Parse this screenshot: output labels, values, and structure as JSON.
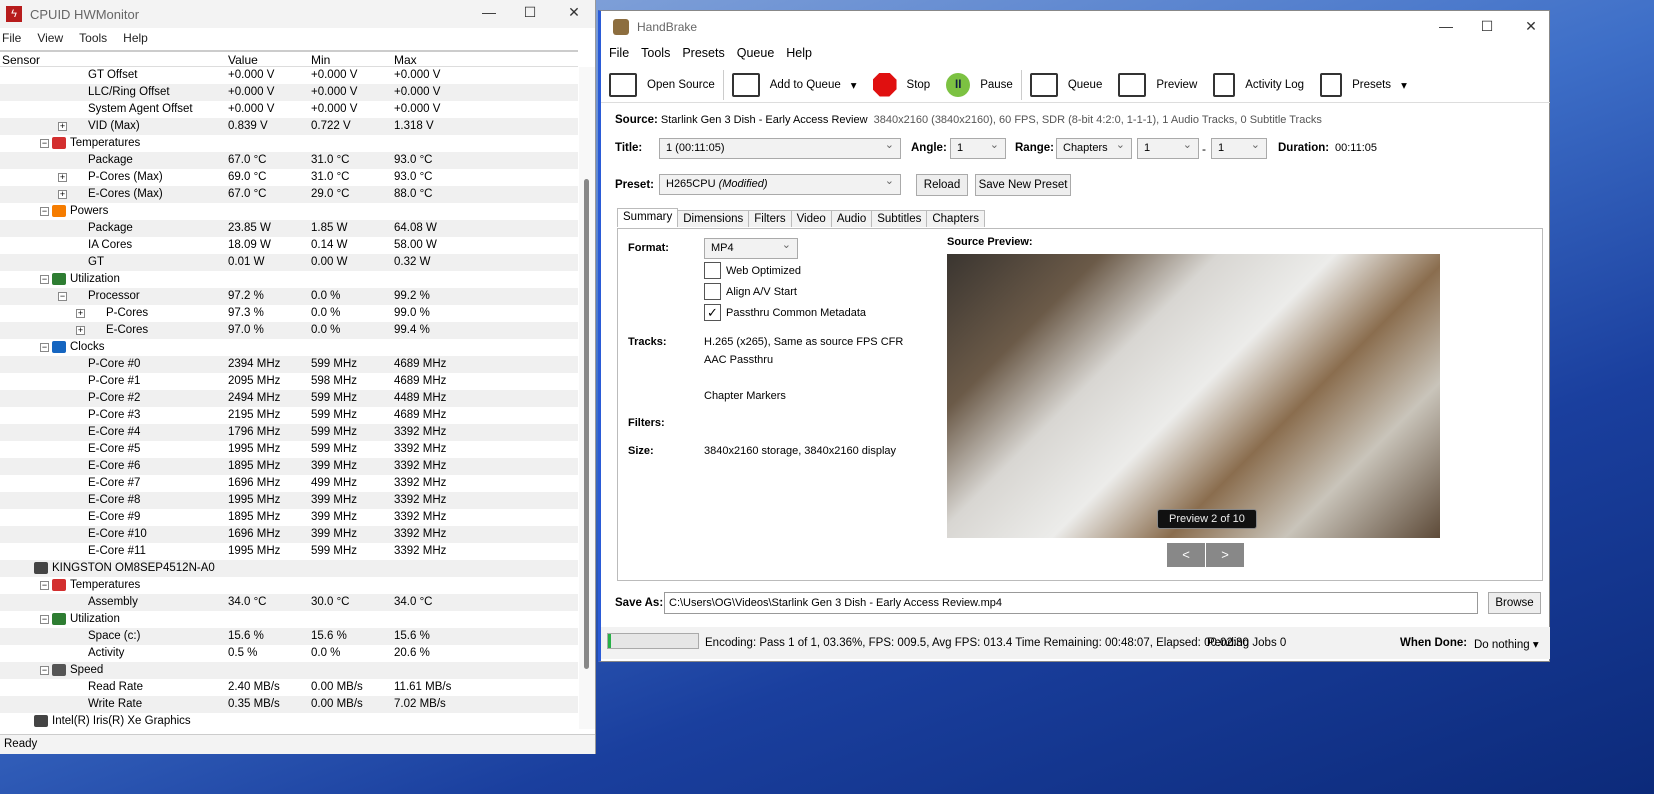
{
  "hwmonitor": {
    "title": "CPUID HWMonitor",
    "menu": [
      "File",
      "View",
      "Tools",
      "Help"
    ],
    "columns": [
      "Sensor",
      "Value",
      "Min",
      "Max"
    ],
    "status": "Ready",
    "rows": [
      {
        "label": "GT Offset",
        "value": "+0.000 V",
        "min": "+0.000 V",
        "max": "+0.000 V",
        "level": 3
      },
      {
        "label": "LLC/Ring Offset",
        "value": "+0.000 V",
        "min": "+0.000 V",
        "max": "+0.000 V",
        "level": 3
      },
      {
        "label": "System Agent Offset",
        "value": "+0.000 V",
        "min": "+0.000 V",
        "max": "+0.000 V",
        "level": 3
      },
      {
        "label": "VID (Max)",
        "value": "0.839 V",
        "min": "0.722 V",
        "max": "1.318 V",
        "level": 3,
        "exp": "+"
      },
      {
        "label": "Temperatures",
        "level": 2,
        "exp": "-",
        "icon": "thermometer-icon",
        "color": "#d32f2f"
      },
      {
        "label": "Package",
        "value": "67.0 °C",
        "min": "31.0 °C",
        "max": "93.0 °C",
        "level": 3
      },
      {
        "label": "P-Cores (Max)",
        "value": "69.0 °C",
        "min": "31.0 °C",
        "max": "93.0 °C",
        "level": 3,
        "exp": "+"
      },
      {
        "label": "E-Cores (Max)",
        "value": "67.0 °C",
        "min": "29.0 °C",
        "max": "88.0 °C",
        "level": 3,
        "exp": "+"
      },
      {
        "label": "Powers",
        "level": 2,
        "exp": "-",
        "icon": "power-flame-icon",
        "color": "#f57c00"
      },
      {
        "label": "Package",
        "value": "23.85 W",
        "min": "1.85 W",
        "max": "64.08 W",
        "level": 3
      },
      {
        "label": "IA Cores",
        "value": "18.09 W",
        "min": "0.14 W",
        "max": "58.00 W",
        "level": 3
      },
      {
        "label": "GT",
        "value": "0.01 W",
        "min": "0.00 W",
        "max": "0.32 W",
        "level": 3
      },
      {
        "label": "Utilization",
        "level": 2,
        "exp": "-",
        "icon": "utilization-icon",
        "color": "#2e7d32"
      },
      {
        "label": "Processor",
        "value": "97.2 %",
        "min": "0.0 %",
        "max": "99.2 %",
        "level": 3,
        "exp": "-"
      },
      {
        "label": "P-Cores",
        "value": "97.3 %",
        "min": "0.0 %",
        "max": "99.0 %",
        "level": 4,
        "exp": "+"
      },
      {
        "label": "E-Cores",
        "value": "97.0 %",
        "min": "0.0 %",
        "max": "99.4 %",
        "level": 4,
        "exp": "+"
      },
      {
        "label": "Clocks",
        "level": 2,
        "exp": "-",
        "icon": "clock-wave-icon",
        "color": "#1565c0"
      },
      {
        "label": "P-Core #0",
        "value": "2394 MHz",
        "min": "599 MHz",
        "max": "4689 MHz",
        "level": 3
      },
      {
        "label": "P-Core #1",
        "value": "2095 MHz",
        "min": "598 MHz",
        "max": "4689 MHz",
        "level": 3
      },
      {
        "label": "P-Core #2",
        "value": "2494 MHz",
        "min": "599 MHz",
        "max": "4489 MHz",
        "level": 3
      },
      {
        "label": "P-Core #3",
        "value": "2195 MHz",
        "min": "599 MHz",
        "max": "4689 MHz",
        "level": 3
      },
      {
        "label": "E-Core #4",
        "value": "1796 MHz",
        "min": "599 MHz",
        "max": "3392 MHz",
        "level": 3
      },
      {
        "label": "E-Core #5",
        "value": "1995 MHz",
        "min": "599 MHz",
        "max": "3392 MHz",
        "level": 3
      },
      {
        "label": "E-Core #6",
        "value": "1895 MHz",
        "min": "399 MHz",
        "max": "3392 MHz",
        "level": 3
      },
      {
        "label": "E-Core #7",
        "value": "1696 MHz",
        "min": "499 MHz",
        "max": "3392 MHz",
        "level": 3
      },
      {
        "label": "E-Core #8",
        "value": "1995 MHz",
        "min": "399 MHz",
        "max": "3392 MHz",
        "level": 3
      },
      {
        "label": "E-Core #9",
        "value": "1895 MHz",
        "min": "399 MHz",
        "max": "3392 MHz",
        "level": 3
      },
      {
        "label": "E-Core #10",
        "value": "1696 MHz",
        "min": "399 MHz",
        "max": "3392 MHz",
        "level": 3
      },
      {
        "label": "E-Core #11",
        "value": "1995 MHz",
        "min": "599 MHz",
        "max": "3392 MHz",
        "level": 3
      },
      {
        "label": "KINGSTON OM8SEP4512N-A0",
        "level": 1,
        "icon": "drive-icon",
        "color": "#444"
      },
      {
        "label": "Temperatures",
        "level": 2,
        "exp": "-",
        "icon": "thermometer-icon",
        "color": "#d32f2f"
      },
      {
        "label": "Assembly",
        "value": "34.0 °C",
        "min": "30.0 °C",
        "max": "34.0 °C",
        "level": 3
      },
      {
        "label": "Utilization",
        "level": 2,
        "exp": "-",
        "icon": "utilization-icon",
        "color": "#2e7d32"
      },
      {
        "label": "Space (c:)",
        "value": "15.6 %",
        "min": "15.6 %",
        "max": "15.6 %",
        "level": 3
      },
      {
        "label": "Activity",
        "value": "0.5 %",
        "min": "0.0 %",
        "max": "20.6 %",
        "level": 3
      },
      {
        "label": "Speed",
        "level": 2,
        "exp": "-",
        "icon": "speed-gauge-icon",
        "color": "#555"
      },
      {
        "label": "Read Rate",
        "value": "2.40 MB/s",
        "min": "0.00 MB/s",
        "max": "11.61 MB/s",
        "level": 3
      },
      {
        "label": "Write Rate",
        "value": "0.35 MB/s",
        "min": "0.00 MB/s",
        "max": "7.02 MB/s",
        "level": 3
      },
      {
        "label": "Intel(R) Iris(R) Xe Graphics",
        "level": 1,
        "icon": "gpu-icon",
        "color": "#444"
      }
    ]
  },
  "handbrake": {
    "title": "HandBrake",
    "menu": [
      "File",
      "Tools",
      "Presets",
      "Queue",
      "Help"
    ],
    "toolbar": {
      "open_source": "Open Source",
      "add_to_queue": "Add to Queue",
      "stop": "Stop",
      "pause": "Pause",
      "queue": "Queue",
      "preview": "Preview",
      "activity_log": "Activity Log",
      "presets": "Presets"
    },
    "source_label": "Source:",
    "source_name": "Starlink Gen 3 Dish - Early Access Review",
    "source_info": "3840x2160 (3840x2160), 60 FPS, SDR (8-bit 4:2:0, 1-1-1), 1 Audio Tracks, 0 Subtitle Tracks",
    "title_label": "Title:",
    "title_value": "1  (00:11:05)",
    "angle_label": "Angle:",
    "angle_value": "1",
    "range_label": "Range:",
    "range_type": "Chapters",
    "range_start": "1",
    "range_sep": "-",
    "range_end": "1",
    "duration_label": "Duration:",
    "duration_value": "00:11:05",
    "preset_label": "Preset:",
    "preset_value": "H265CPU",
    "preset_modified": "(Modified)",
    "reload": "Reload",
    "save_new_preset": "Save New Preset",
    "tabs": [
      "Summary",
      "Dimensions",
      "Filters",
      "Video",
      "Audio",
      "Subtitles",
      "Chapters"
    ],
    "summary": {
      "format_label": "Format:",
      "format_value": "MP4",
      "web_optimized": "Web Optimized",
      "align_av": "Align A/V Start",
      "passthru": "Passthru Common Metadata",
      "checks": {
        "web_optimized": false,
        "align_av": false,
        "passthru": true
      },
      "tracks_label": "Tracks:",
      "tracks": [
        "H.265 (x265), Same as source FPS CFR",
        "AAC Passthru",
        "",
        "Chapter Markers"
      ],
      "filters_label": "Filters:",
      "size_label": "Size:",
      "size_value": "3840x2160 storage, 3840x2160 display",
      "source_preview_label": "Source Preview:",
      "preview_counter": "Preview 2 of 10",
      "prev": "<",
      "next": ">"
    },
    "save_as_label": "Save As:",
    "save_as_value": "C:\\Users\\OG\\Videos\\Starlink Gen 3 Dish - Early Access Review.mp4",
    "browse": "Browse",
    "progress_percent": 3.36,
    "status_text": "Encoding: Pass 1 of 1,  03.36%, FPS: 009.5,  Avg FPS: 013.4 Time Remaining: 00:48:07,  Elapsed: 00:02:30",
    "pending_jobs": "Pending Jobs 0",
    "when_done_label": "When Done:",
    "when_done_value": "Do nothing"
  }
}
